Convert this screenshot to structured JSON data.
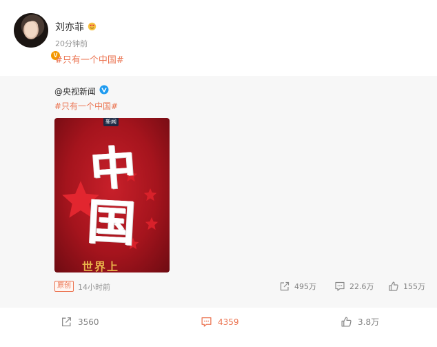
{
  "post": {
    "username": "刘亦菲",
    "timestamp": "20分钟前",
    "hashtag": "#只有一个中国#",
    "avatar_icon": "user-avatar",
    "verify_icon": "orange-v-badge",
    "vip_icon": "heart-eyes-emoji-icon"
  },
  "repost": {
    "author": "@央视新闻",
    "author_icon": "blue-v-verified-icon",
    "hashtag": "#只有一个中国#",
    "poster": {
      "tag": "新闻",
      "char1": "中",
      "char2": "国",
      "subtitle": "世界上"
    },
    "source_badge": "原创",
    "time": "14小时前",
    "share_count": "495万",
    "comment_count": "22.6万",
    "like_count": "155万"
  },
  "actions": {
    "share_count": "3560",
    "comment_count": "4359",
    "like_count": "3.8万"
  },
  "colors": {
    "accent": "#eb7350",
    "verified_orange": "#f39800",
    "verified_blue": "#1f9bf0",
    "poster_red": "#b0161f"
  }
}
